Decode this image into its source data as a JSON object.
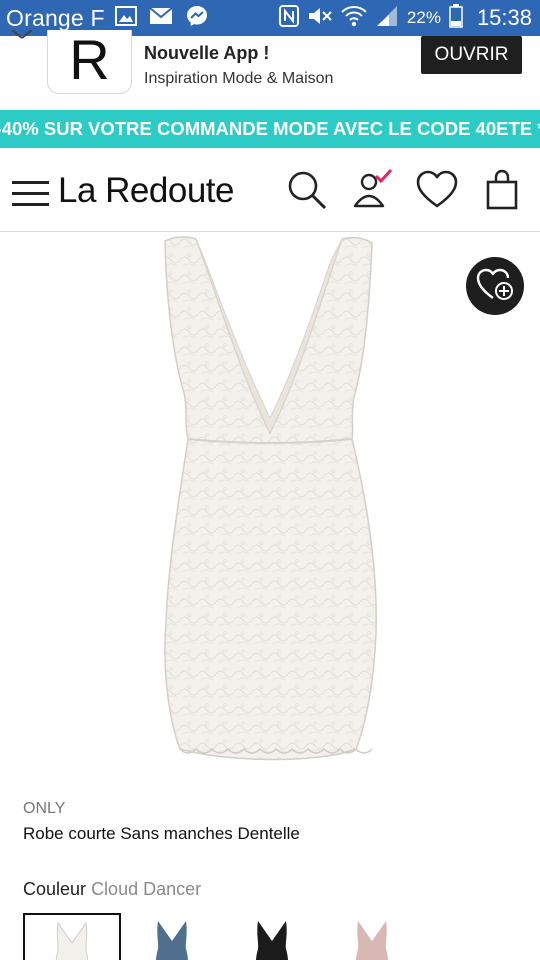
{
  "status_bar": {
    "carrier": "Orange F",
    "battery_percent": "22%",
    "time": "15:38",
    "icons": [
      "image-icon",
      "mail-icon",
      "messenger-icon",
      "nfc-icon",
      "mute-icon",
      "wifi-icon",
      "signal-icon",
      "battery-icon"
    ],
    "background_color": "#2e67b4"
  },
  "app_banner": {
    "logo_letter": "R",
    "title": "Nouvelle App !",
    "subtitle": "Inspiration Mode & Maison",
    "open_label": "OUVRIR"
  },
  "promo": {
    "text": "-40% SUR VOTRE COMMANDE MODE AVEC LE CODE 40ETE *",
    "background_color": "#2ccbc6"
  },
  "header": {
    "brand": "La Redoute",
    "icons": [
      "menu-icon",
      "search-icon",
      "account-icon",
      "wishlist-icon",
      "bag-icon"
    ],
    "accent_color": "#e6245e"
  },
  "product": {
    "brand": "ONLY",
    "name": "Robe courte Sans manches Dentelle",
    "color_label": "Couleur",
    "color_value": "Cloud Dancer",
    "swatches": [
      {
        "name": "Cloud Dancer",
        "color": "#f3f1ec",
        "selected": true
      },
      {
        "name": "denim",
        "color": "#4f6f8f",
        "selected": false
      },
      {
        "name": "black",
        "color": "#1b1b1b",
        "selected": false
      },
      {
        "name": "pink",
        "color": "#d9b7b3",
        "selected": false
      }
    ]
  }
}
